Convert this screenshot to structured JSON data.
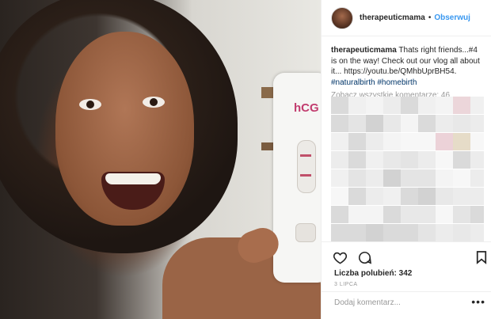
{
  "user": {
    "username": "therapeuticmama",
    "separator": "•",
    "follow_label": "Obserwuj"
  },
  "caption": {
    "username": "therapeuticmama",
    "text": "Thats right friends...#4 is on the way! Check out our vlog all about it... https://youtu.be/QMhbUprBH54.",
    "hashtags": "#naturalbirth #homebirth"
  },
  "comments": {
    "view_all": "Zobacz wszystkie komentarze: 46"
  },
  "actions": {
    "likes": "Liczba polubień: 342",
    "date": "3 LIPCA",
    "add_comment_placeholder": "Dodaj komentarz...",
    "more": "•••"
  },
  "icons": {
    "like": "heart-icon",
    "comment": "comment-icon",
    "save": "bookmark-icon",
    "options": "more-options-icon"
  },
  "colors": {
    "follow": "#3897f0",
    "hashtag": "#003569",
    "muted": "#999999"
  }
}
